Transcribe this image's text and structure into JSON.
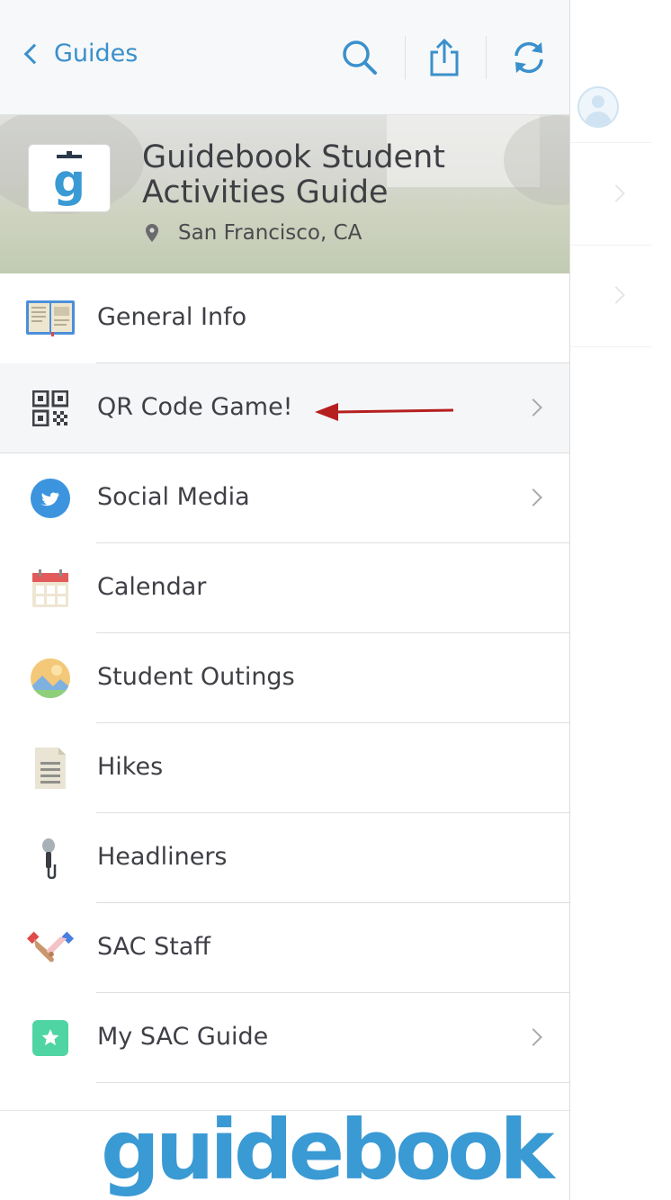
{
  "nav": {
    "back_label": "Guides",
    "icons": [
      "search-icon",
      "share-icon",
      "refresh-icon"
    ]
  },
  "guide": {
    "title_line1": "Guidebook Student",
    "title_line2": "Activities Guide",
    "location": "San Francisco, CA",
    "logo_letter": "g"
  },
  "menu": [
    {
      "label": "General Info",
      "icon": "book-icon",
      "chevron": false
    },
    {
      "label": "QR Code Game!",
      "icon": "qr-code-icon",
      "chevron": true,
      "active": true
    },
    {
      "label": "Social Media",
      "icon": "twitter-icon",
      "chevron": true
    },
    {
      "label": "Calendar",
      "icon": "calendar-icon",
      "chevron": false
    },
    {
      "label": "Student Outings",
      "icon": "landscape-icon",
      "chevron": false
    },
    {
      "label": "Hikes",
      "icon": "document-icon",
      "chevron": false
    },
    {
      "label": "Headliners",
      "icon": "microphone-icon",
      "chevron": false
    },
    {
      "label": "SAC Staff",
      "icon": "handshake-icon",
      "chevron": false
    },
    {
      "label": "My SAC Guide",
      "icon": "star-icon",
      "chevron": true
    }
  ],
  "footer": {
    "wordmark": "guidebook"
  },
  "colors": {
    "accent": "#3a90cc",
    "arrow": "#b5201f"
  }
}
